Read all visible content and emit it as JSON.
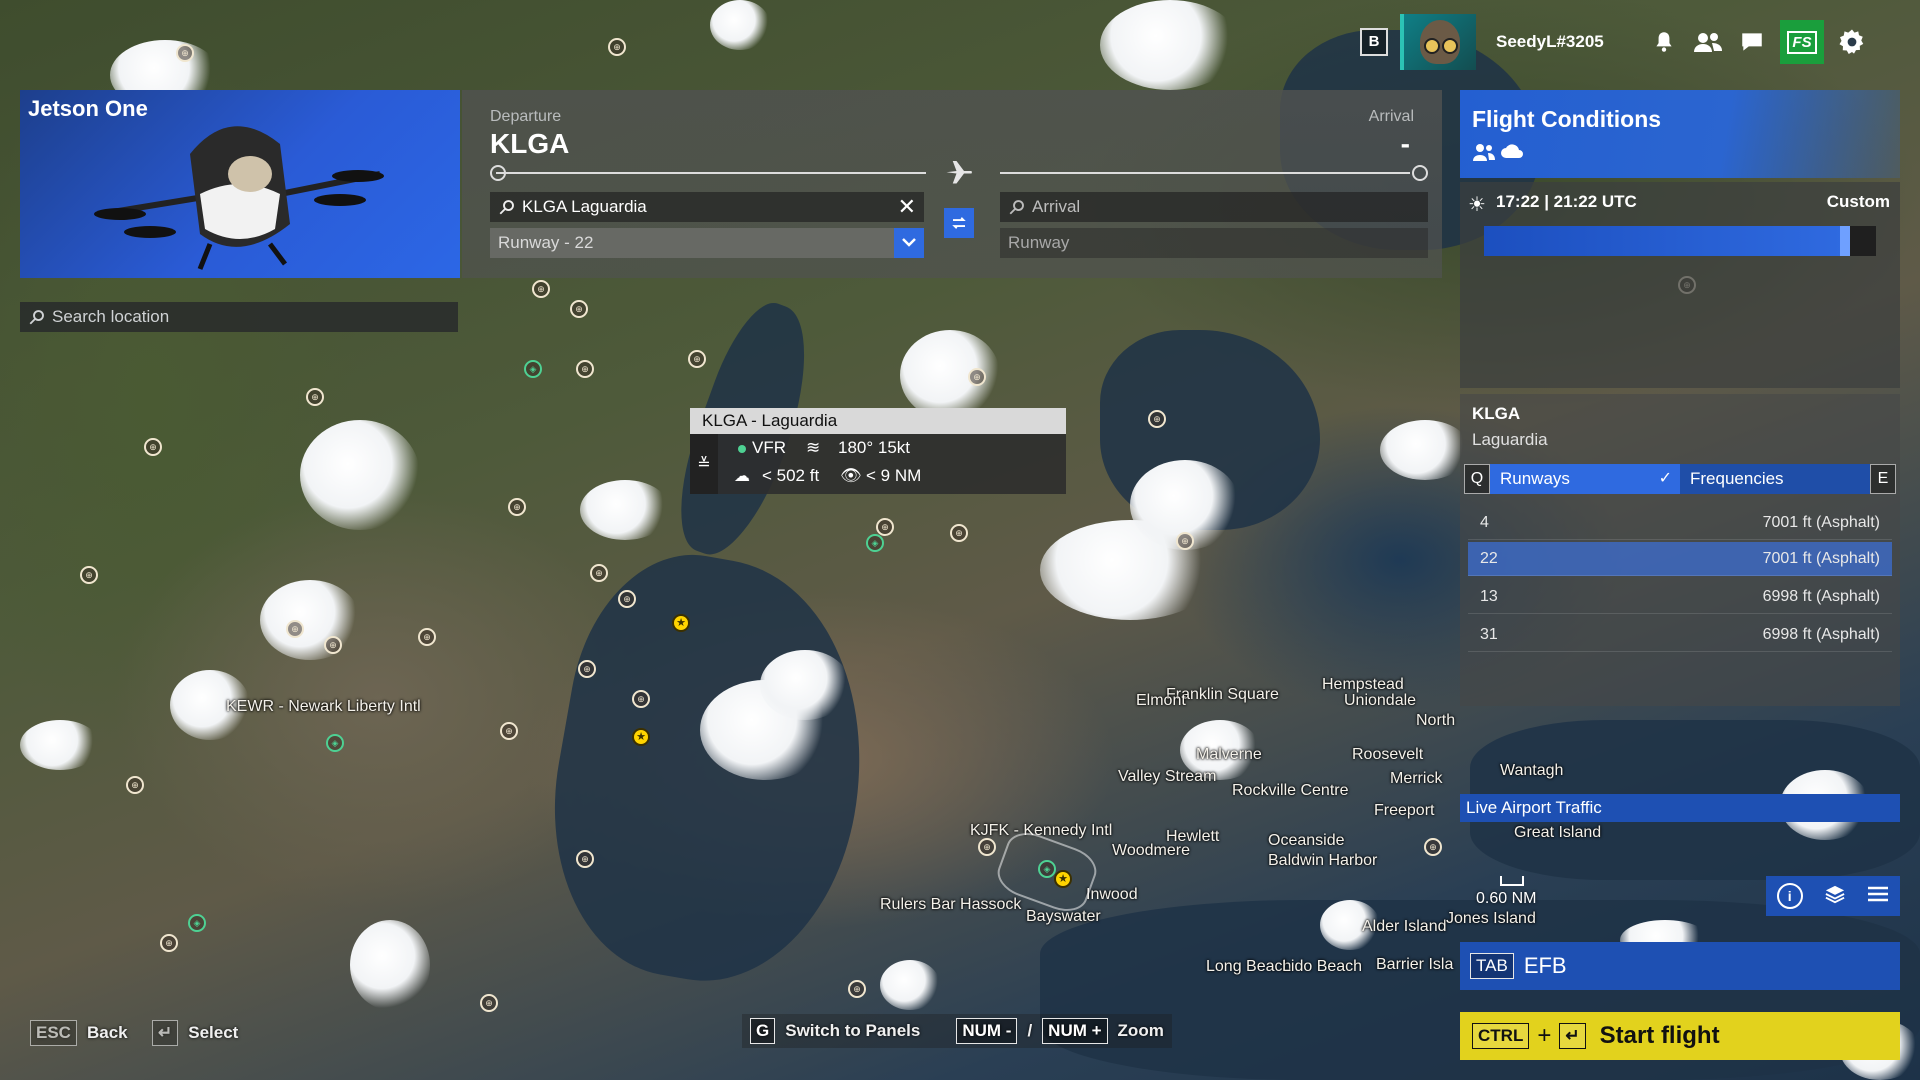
{
  "topbar": {
    "badge": "B",
    "username": "SeedyL#3205",
    "fs_label": "FS"
  },
  "aircraft": {
    "name": "Jetson One"
  },
  "search": {
    "placeholder": "Search location"
  },
  "route": {
    "departure_label": "Departure",
    "departure_code": "KLGA",
    "arrival_label": "Arrival",
    "arrival_code": "-",
    "departure_search_value": "KLGA Laguardia",
    "departure_runway": "Runway - 22",
    "arrival_placeholder": "Arrival",
    "arrival_runway_placeholder": "Runway"
  },
  "conditions": {
    "title": "Flight Conditions",
    "time_text": "17:22 | 21:22 UTC",
    "mode": "Custom",
    "time_slider_fraction": 0.92
  },
  "airport": {
    "code": "KLGA",
    "name": "Laguardia",
    "tab_left_key": "Q",
    "tab_runways": "Runways",
    "tab_frequencies": "Frequencies",
    "tab_right_key": "E",
    "runways": [
      {
        "id": "4",
        "length": "7001 ft (Asphalt)"
      },
      {
        "id": "22",
        "length": "7001 ft (Asphalt)"
      },
      {
        "id": "13",
        "length": "6998 ft (Asphalt)"
      },
      {
        "id": "31",
        "length": "6998 ft (Asphalt)"
      }
    ],
    "live_traffic": "Live Airport Traffic"
  },
  "tooltip": {
    "title": "KLGA - Laguardia",
    "rule": "VFR",
    "wind": "180° 15kt",
    "ceiling": "< 502 ft",
    "visibility": "< 9 NM"
  },
  "map": {
    "labels": [
      "KEWR - Newark Liberty Intl",
      "Franklin Square",
      "Hempstead",
      "Uniondale",
      "Elmont",
      "North",
      "Malverne",
      "Roosevelt",
      "Valley Stream",
      "Merrick",
      "Wantagh",
      "Rockville Centre",
      "Freeport",
      "KJFK - Kennedy Intl",
      "Hewlett",
      "Oceanside",
      "Woodmere",
      "Baldwin Harbor",
      "Great Island",
      "Inwood",
      "Rulers Bar Hassock",
      "Bayswater",
      "Alder Island",
      "Jones Island",
      "Long Beach",
      "Lido Beach",
      "Barrier Isla"
    ],
    "scale": "0.60 NM"
  },
  "efb": {
    "key": "TAB",
    "label": "EFB"
  },
  "start": {
    "key": "CTRL",
    "plus": "+",
    "label": "Start flight"
  },
  "hints": {
    "back_key": "ESC",
    "back": "Back",
    "select": "Select",
    "switch_key": "G",
    "switch": "Switch to Panels",
    "num_minus": "NUM -",
    "slash": "/",
    "num_plus": "NUM +",
    "zoom": "Zoom"
  },
  "colors": {
    "accent_blue": "#2f6ae0",
    "start_yellow": "#e2d21d",
    "vfr_green": "#4ed193"
  }
}
